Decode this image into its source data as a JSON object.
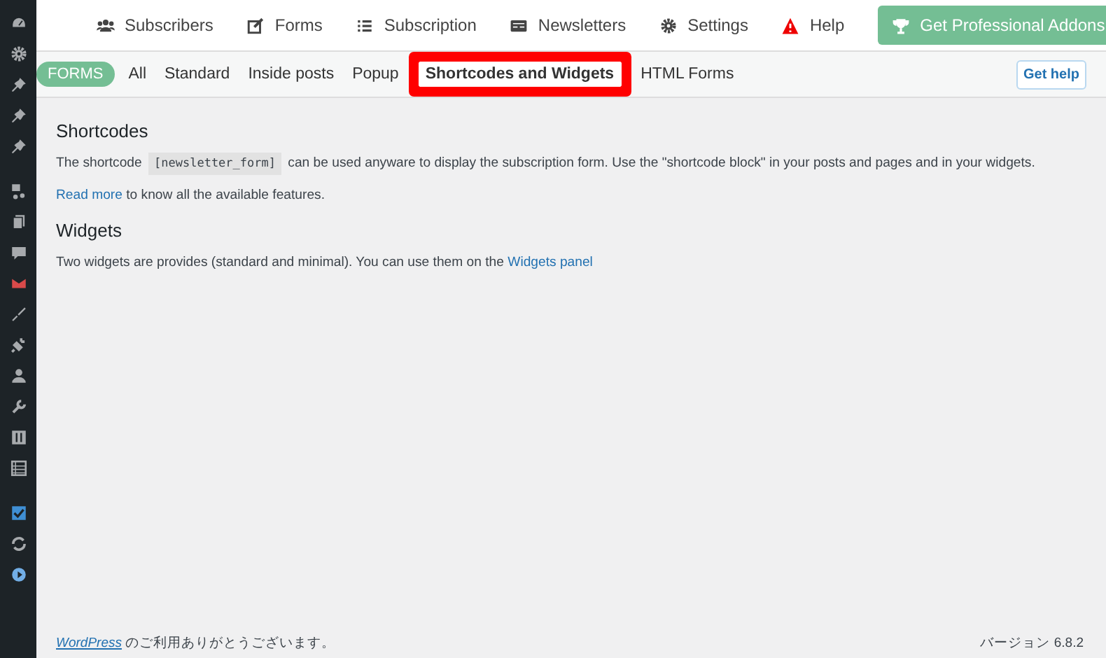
{
  "nav": [
    {
      "label": "Subscribers"
    },
    {
      "label": "Forms"
    },
    {
      "label": "Subscription"
    },
    {
      "label": "Newsletters"
    },
    {
      "label": "Settings"
    },
    {
      "label": "Help"
    }
  ],
  "promo_button": "Get Professional Addons",
  "section_badge": "FORMS",
  "tabs": [
    {
      "label": "All",
      "selected": false
    },
    {
      "label": "Standard",
      "selected": false
    },
    {
      "label": "Inside posts",
      "selected": false
    },
    {
      "label": "Popup",
      "selected": false
    },
    {
      "label": "Shortcodes and Widgets",
      "selected": true
    },
    {
      "label": "HTML Forms",
      "selected": false
    }
  ],
  "help_button": "Get help",
  "shortcodes": {
    "title": "Shortcodes",
    "text_before": "The shortcode",
    "code": "[newsletter_form]",
    "text_after": "can be used anyware to display the subscription form. Use the \"shortcode block\" in your posts and pages and in your widgets.",
    "link": "Read more",
    "link_after": "to know all the available features."
  },
  "widgets": {
    "title": "Widgets",
    "text": "Two widgets are provides (standard and minimal). You can use them on the",
    "link": "Widgets panel"
  },
  "footer": {
    "link": "WordPress",
    "text": "のご利用ありがとうございます。",
    "version": "バージョン 6.8.2"
  }
}
